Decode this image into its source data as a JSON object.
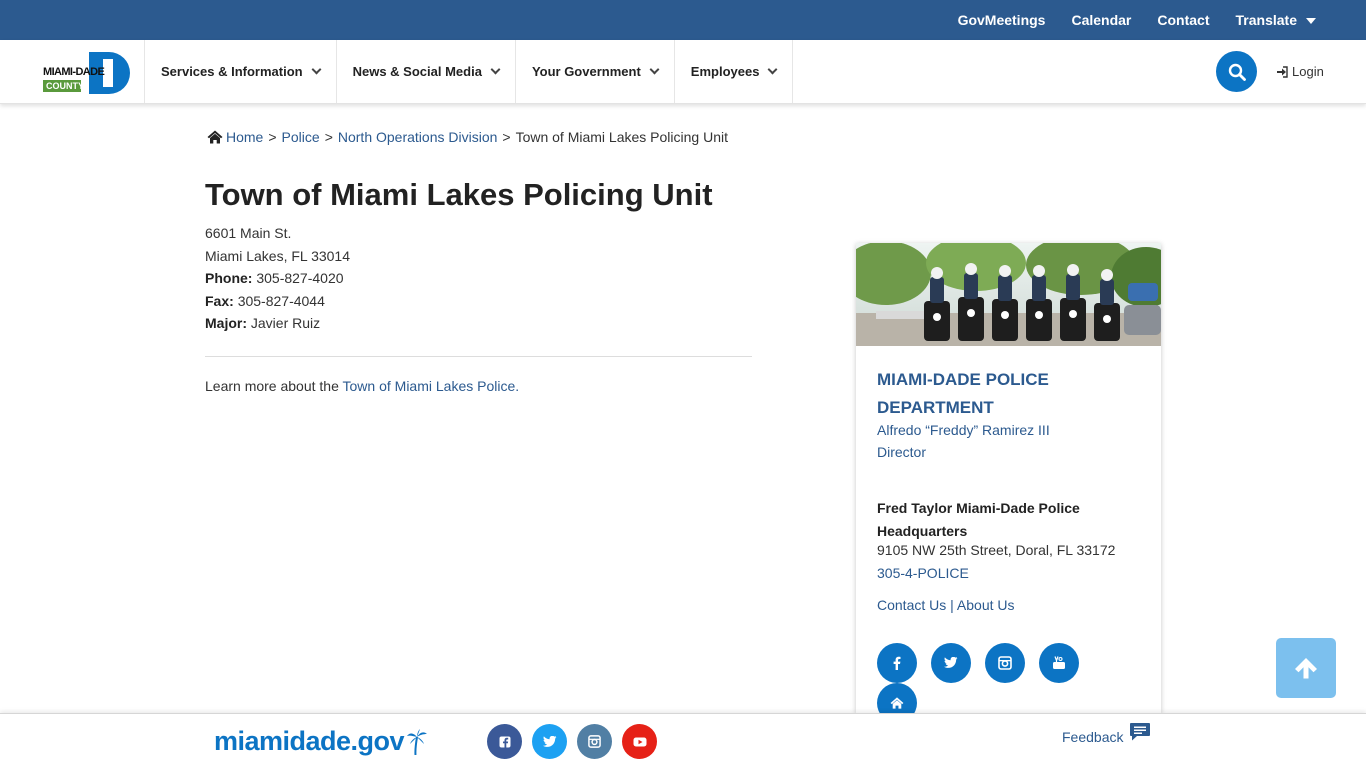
{
  "topbar": {
    "links": [
      "GovMeetings",
      "Calendar",
      "Contact"
    ],
    "translate_label": "Translate"
  },
  "logo": {
    "line1": "MIAMI-DADE",
    "line2": "COUNTY"
  },
  "nav": {
    "items": [
      "Services & Information",
      "News & Social Media",
      "Your Government",
      "Employees"
    ],
    "login_label": "Login"
  },
  "breadcrumb": {
    "home": "Home",
    "sep": ">",
    "police": "Police",
    "division": "North Operations Division",
    "current": "Town of Miami Lakes Policing Unit"
  },
  "page": {
    "title": "Town of Miami Lakes Policing Unit",
    "street": "6601 Main St.",
    "city": "Miami Lakes, FL 33014",
    "phone_label": "Phone:",
    "phone": "305-827-4020",
    "fax_label": "Fax:",
    "fax": "305-827-4044",
    "major_label": "Major:",
    "major": "Javier Ruiz",
    "learn_prefix": "Learn more about the",
    "learn_link": "Town of Miami Lakes Police."
  },
  "sidebar": {
    "department": "MIAMI-DADE POLICE DEPARTMENT",
    "director_name": "Alfredo “Freddy” Ramirez III",
    "director_title": "Director",
    "hq_name": "Fred Taylor Miami-Dade Police Headquarters",
    "hq_address": "9105 NW 25th Street, Doral, FL 33172",
    "hq_phone": "305-4-POLICE",
    "contact_label": "Contact Us",
    "link_sep": "|",
    "about_label": "About Us",
    "social_icons": [
      "facebook-icon",
      "twitter-icon",
      "instagram-icon",
      "youtube-icon",
      "home-icon"
    ]
  },
  "footer": {
    "brand": "miamidade.gov",
    "social_icons": [
      "facebook-icon",
      "twitter-icon",
      "instagram-icon",
      "youtube-icon"
    ],
    "feedback_label": "Feedback"
  },
  "colors": {
    "topbar": "#2c5a8f",
    "link": "#2c5a8f",
    "accent_blue": "#0c74c4",
    "back_to_top": "#7cc0ee",
    "facebook": "#3b5998",
    "twitter": "#1da1f2",
    "instagram": "#517fa4",
    "youtube": "#e62117",
    "logo_green": "#5a9a3c"
  }
}
